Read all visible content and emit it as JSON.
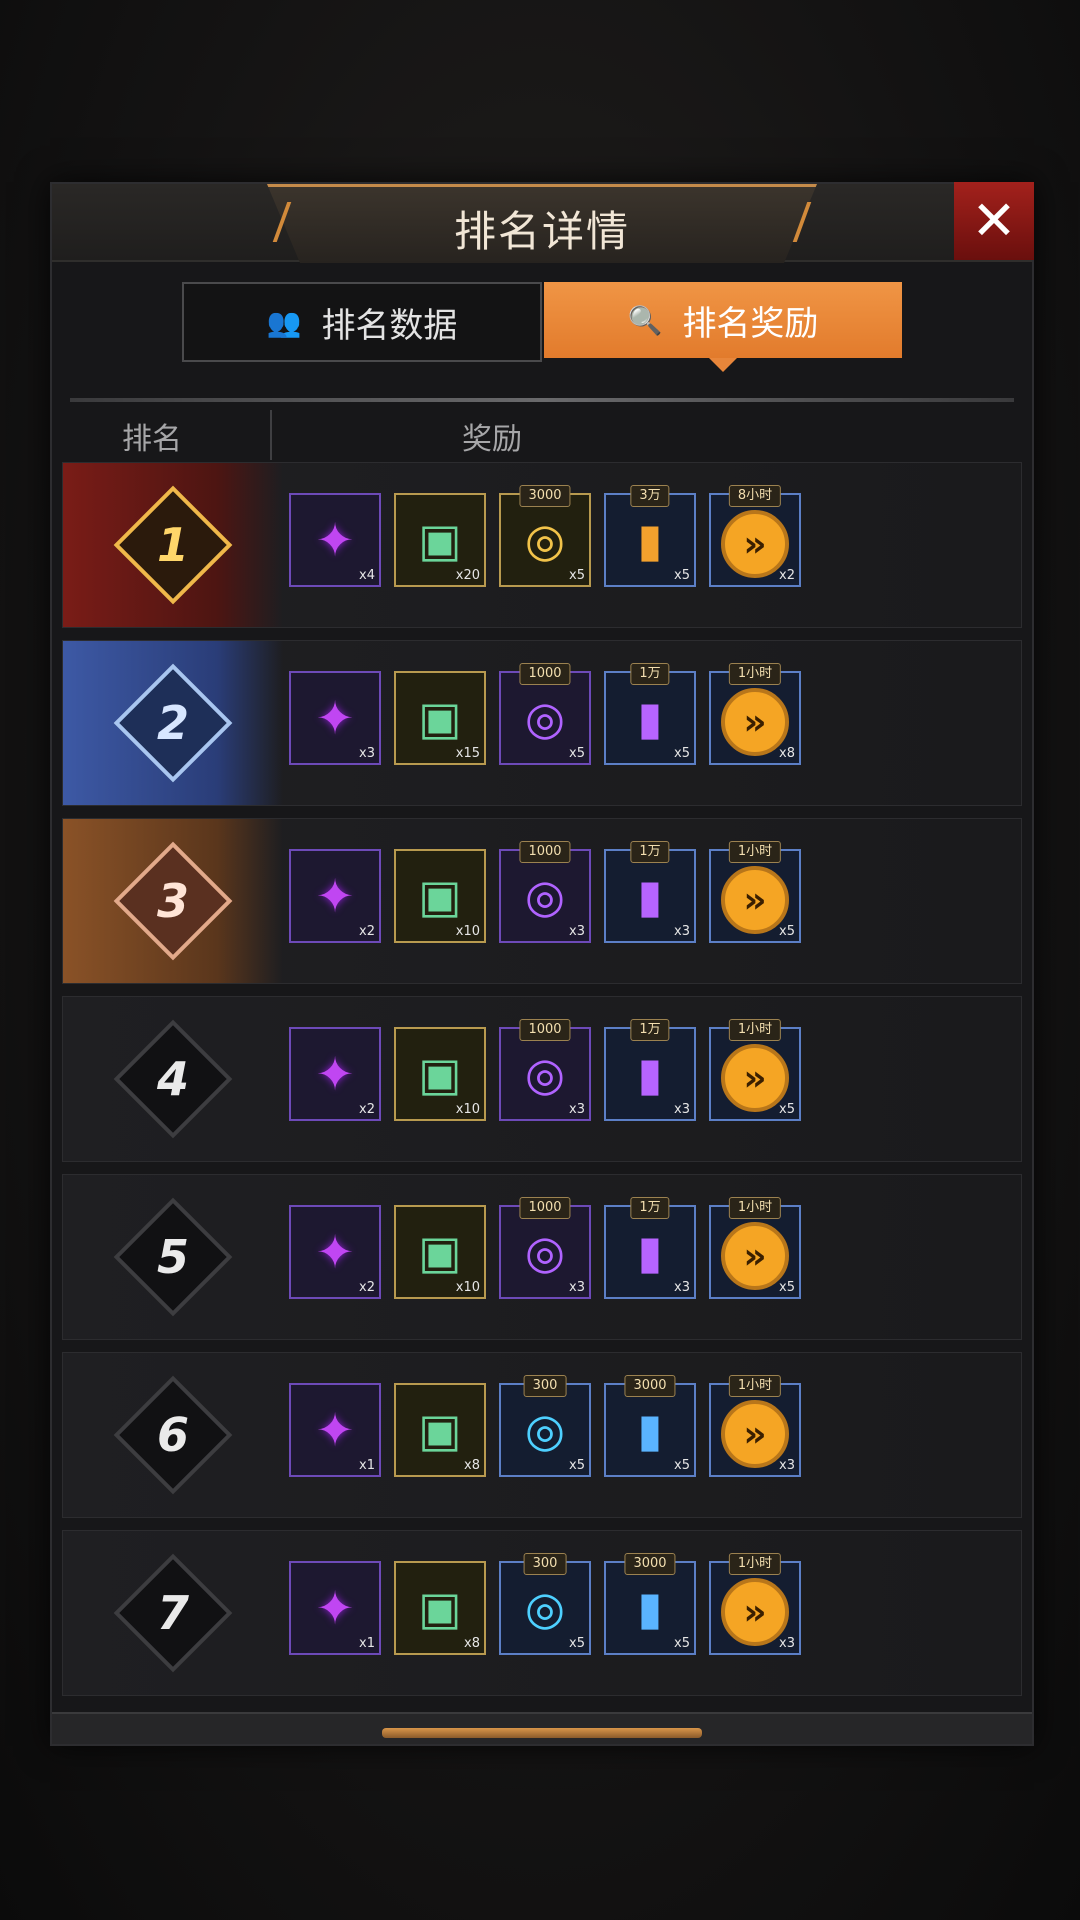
{
  "dialog": {
    "title": "排名详情",
    "close_symbol": "✕",
    "tabs": [
      {
        "label": "排名数据",
        "icon": "users-icon",
        "icon_glyph": "👥",
        "active": false
      },
      {
        "label": "排名奖励",
        "icon": "search-icon",
        "icon_glyph": "🔍",
        "active": true
      }
    ],
    "columns": {
      "rank": "排名",
      "reward": "奖励"
    }
  },
  "rows": [
    {
      "rank": "1",
      "items": [
        {
          "type": "puzzle",
          "qty": "x4",
          "badge": ""
        },
        {
          "type": "crate",
          "qty": "x20",
          "badge": ""
        },
        {
          "type": "pad-gold",
          "qty": "x5",
          "badge": "3000"
        },
        {
          "type": "tube-gold",
          "qty": "x5",
          "badge": "3万"
        },
        {
          "type": "speed",
          "qty": "x2",
          "badge": "8小时"
        }
      ]
    },
    {
      "rank": "2",
      "items": [
        {
          "type": "puzzle",
          "qty": "x3",
          "badge": ""
        },
        {
          "type": "crate",
          "qty": "x15",
          "badge": ""
        },
        {
          "type": "pad-purple",
          "qty": "x5",
          "badge": "1000"
        },
        {
          "type": "tube-purple",
          "qty": "x5",
          "badge": "1万"
        },
        {
          "type": "speed",
          "qty": "x8",
          "badge": "1小时"
        }
      ]
    },
    {
      "rank": "3",
      "items": [
        {
          "type": "puzzle",
          "qty": "x2",
          "badge": ""
        },
        {
          "type": "crate",
          "qty": "x10",
          "badge": ""
        },
        {
          "type": "pad-purple",
          "qty": "x3",
          "badge": "1000"
        },
        {
          "type": "tube-purple",
          "qty": "x3",
          "badge": "1万"
        },
        {
          "type": "speed",
          "qty": "x5",
          "badge": "1小时"
        }
      ]
    },
    {
      "rank": "4",
      "items": [
        {
          "type": "puzzle",
          "qty": "x2",
          "badge": ""
        },
        {
          "type": "crate",
          "qty": "x10",
          "badge": ""
        },
        {
          "type": "pad-purple",
          "qty": "x3",
          "badge": "1000"
        },
        {
          "type": "tube-purple",
          "qty": "x3",
          "badge": "1万"
        },
        {
          "type": "speed",
          "qty": "x5",
          "badge": "1小时"
        }
      ]
    },
    {
      "rank": "5",
      "items": [
        {
          "type": "puzzle",
          "qty": "x2",
          "badge": ""
        },
        {
          "type": "crate",
          "qty": "x10",
          "badge": ""
        },
        {
          "type": "pad-purple",
          "qty": "x3",
          "badge": "1000"
        },
        {
          "type": "tube-purple",
          "qty": "x3",
          "badge": "1万"
        },
        {
          "type": "speed",
          "qty": "x5",
          "badge": "1小时"
        }
      ]
    },
    {
      "rank": "6",
      "items": [
        {
          "type": "puzzle",
          "qty": "x1",
          "badge": ""
        },
        {
          "type": "crate",
          "qty": "x8",
          "badge": ""
        },
        {
          "type": "pad-blue",
          "qty": "x5",
          "badge": "300"
        },
        {
          "type": "tube-blue",
          "qty": "x5",
          "badge": "3000"
        },
        {
          "type": "speed",
          "qty": "x3",
          "badge": "1小时"
        }
      ]
    },
    {
      "rank": "7",
      "items": [
        {
          "type": "puzzle",
          "qty": "x1",
          "badge": ""
        },
        {
          "type": "crate",
          "qty": "x8",
          "badge": ""
        },
        {
          "type": "pad-blue",
          "qty": "x5",
          "badge": "300"
        },
        {
          "type": "tube-blue",
          "qty": "x5",
          "badge": "3000"
        },
        {
          "type": "speed",
          "qty": "x3",
          "badge": "1小时"
        }
      ]
    }
  ],
  "colors": {
    "accent": "#e8863a",
    "close": "#a3211c",
    "rank1": "#7a1c17",
    "rank2": "#3d59a5",
    "rank3": "#8a5227"
  }
}
